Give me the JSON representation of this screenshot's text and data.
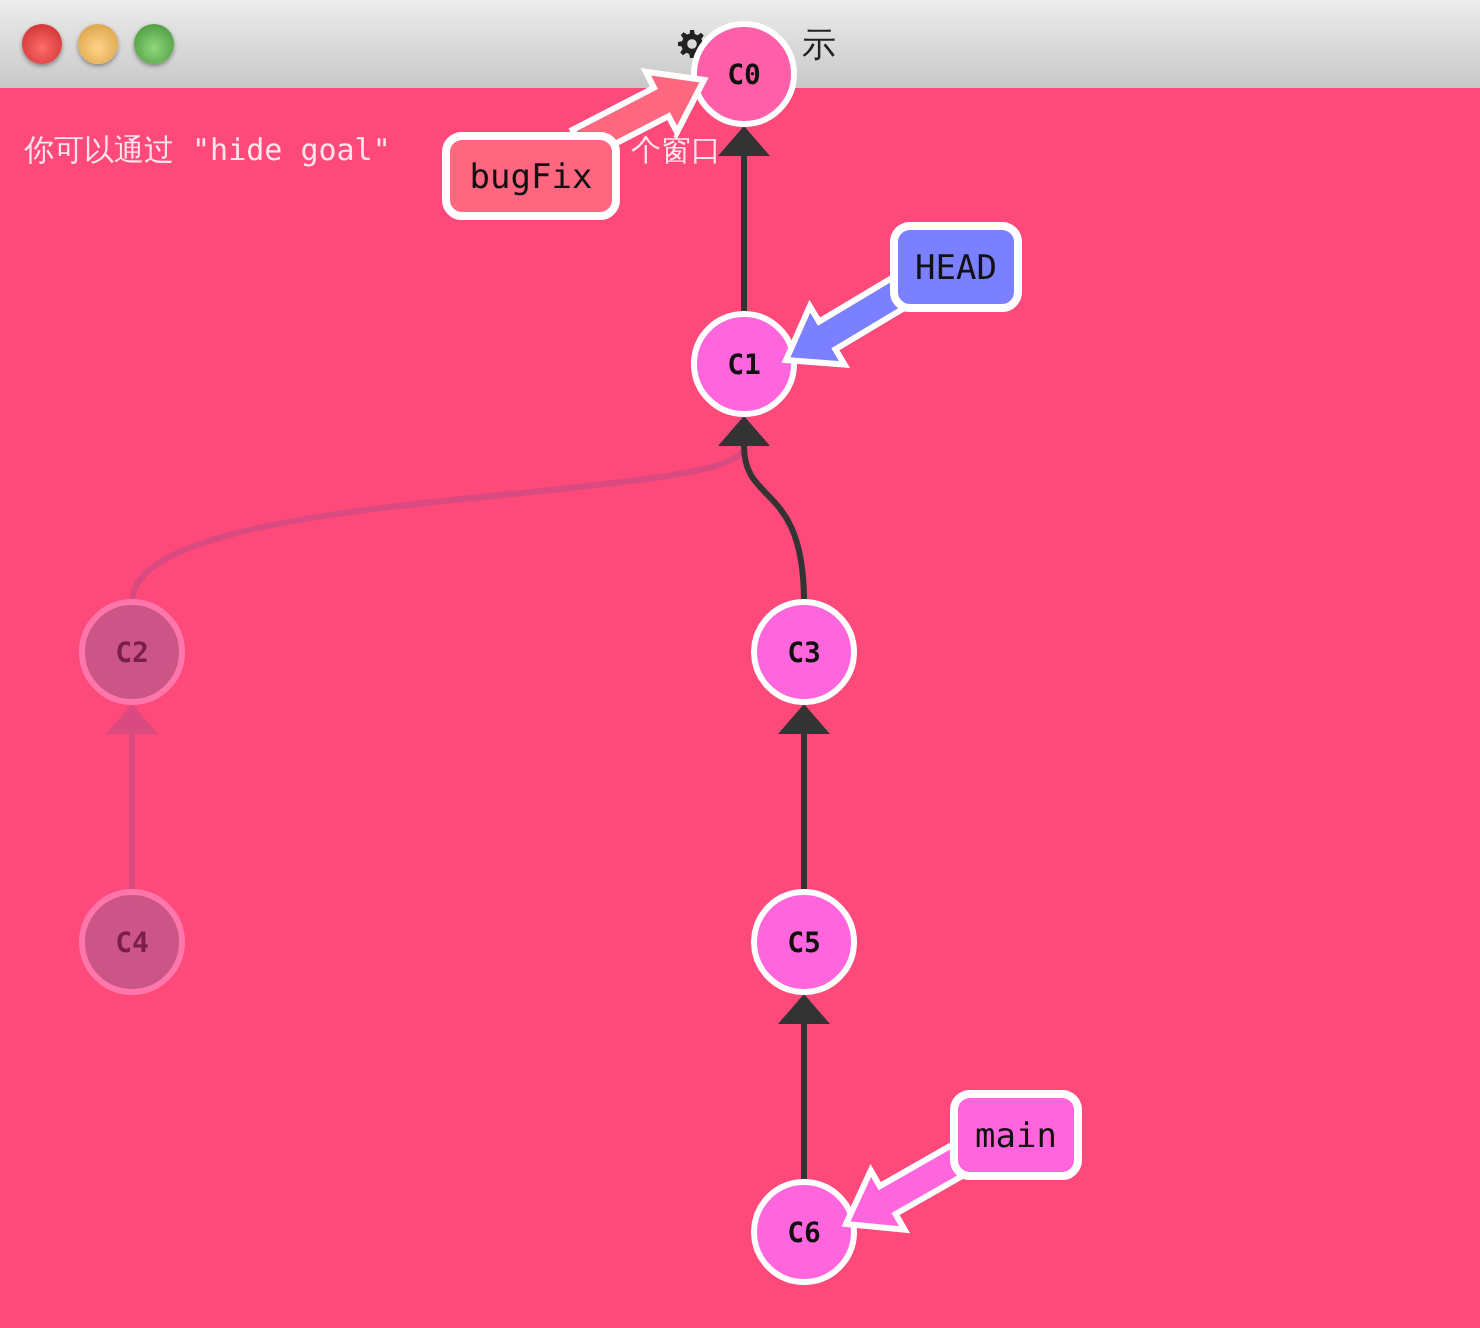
{
  "window": {
    "title": "示"
  },
  "goal_text": {
    "before": "你可以通过 \"hide goal\"",
    "after": "个窗口"
  },
  "commits": [
    {
      "label": "C0",
      "faded": false
    },
    {
      "label": "C1",
      "faded": false
    },
    {
      "label": "C2",
      "faded": true
    },
    {
      "label": "C3",
      "faded": false
    },
    {
      "label": "C4",
      "faded": true
    },
    {
      "label": "C5",
      "faded": false
    },
    {
      "label": "C6",
      "faded": false
    }
  ],
  "branches": [
    {
      "name": "bugFix",
      "color": "#ff6680"
    },
    {
      "name": "HEAD",
      "color": "#7a80ff"
    },
    {
      "name": "main",
      "color": "#ff66dd"
    }
  ]
}
